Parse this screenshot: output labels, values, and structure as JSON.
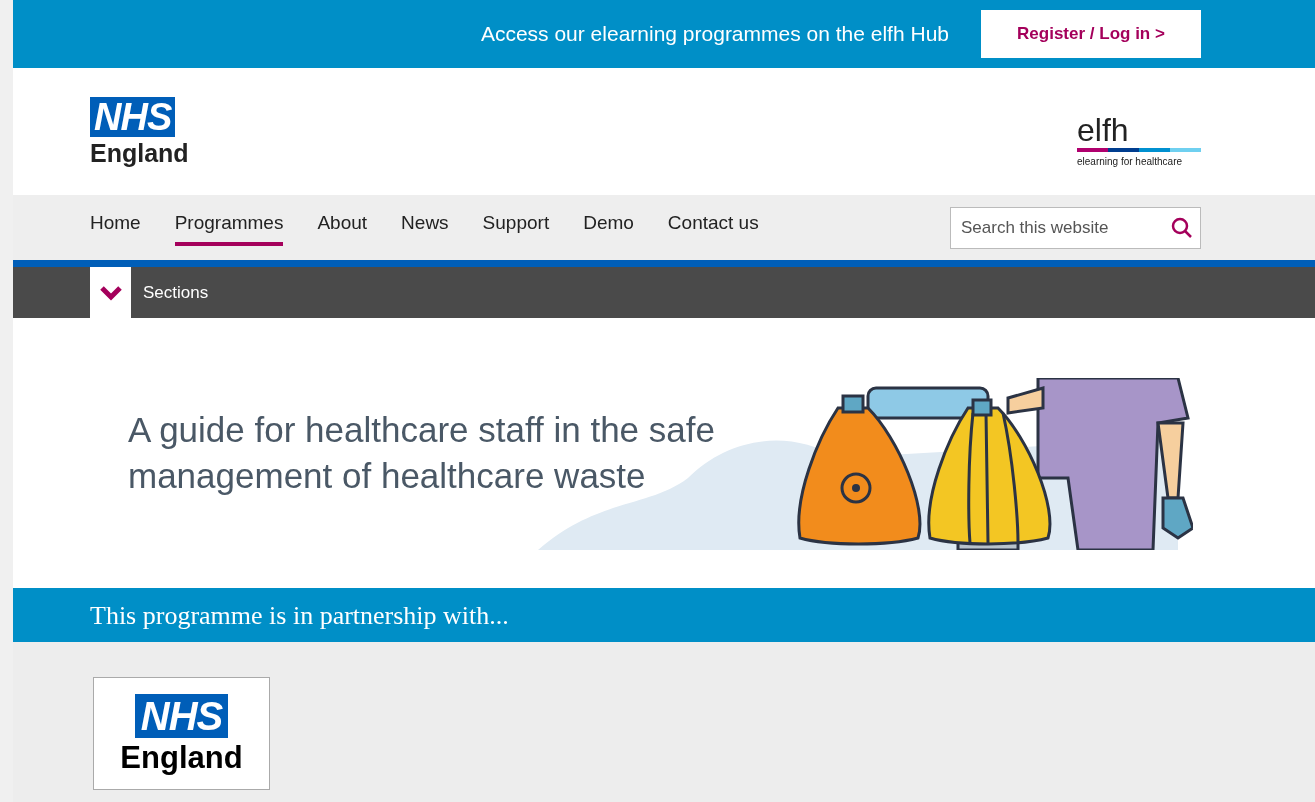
{
  "top_bar": {
    "message": "Access our elearning programmes on the elfh Hub",
    "button": "Register / Log in >"
  },
  "header": {
    "logo": {
      "mark": "NHS",
      "name": "England"
    },
    "partner_logo": {
      "name": "elfh",
      "tagline": "elearning for healthcare"
    }
  },
  "nav": {
    "items": [
      {
        "label": "Home",
        "selected": false
      },
      {
        "label": "Programmes",
        "selected": true
      },
      {
        "label": "About",
        "selected": false
      },
      {
        "label": "News",
        "selected": false
      },
      {
        "label": "Support",
        "selected": false
      },
      {
        "label": "Demo",
        "selected": false
      },
      {
        "label": "Contact us",
        "selected": false
      }
    ],
    "search": {
      "placeholder": "Search this website"
    }
  },
  "sections_bar": {
    "label": "Sections",
    "expanded": false
  },
  "banner": {
    "lines": [
      "A guide for healthcare staff in the safe",
      "management of healthcare waste"
    ]
  },
  "partnership": {
    "heading": "This programme is in partnership with...",
    "logos": [
      {
        "mark": "NHS",
        "name": "England"
      }
    ]
  }
}
